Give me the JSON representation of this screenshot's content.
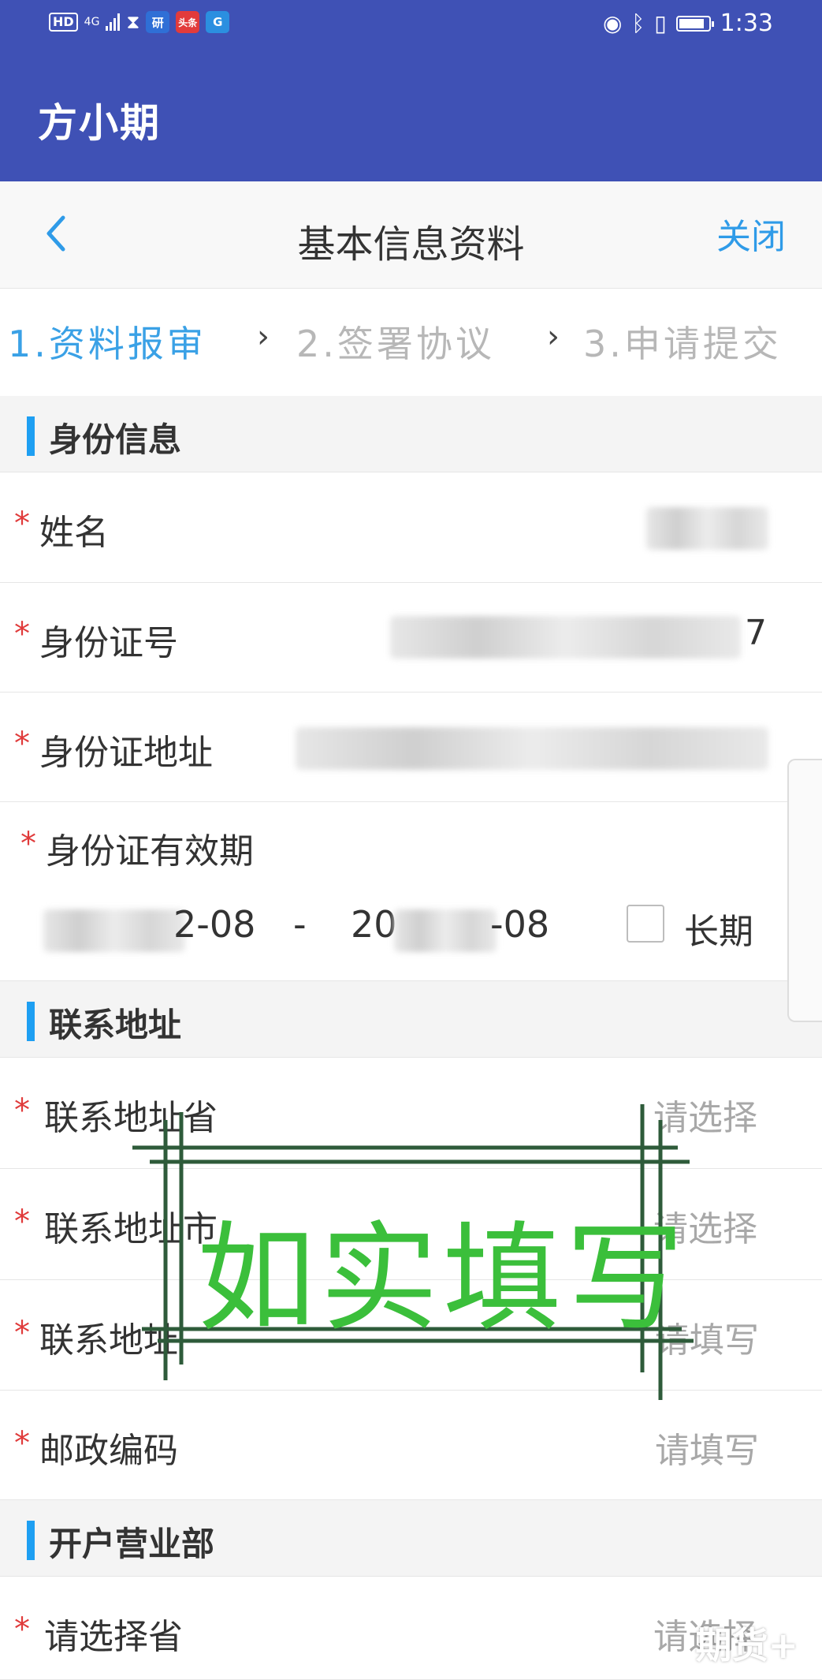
{
  "status_bar": {
    "hd": "HD",
    "network": "4G",
    "app_icons": [
      {
        "name": "research-app-icon",
        "label": "研",
        "color": "#2f6fd6"
      },
      {
        "name": "toutiao-app-icon",
        "label": "头条",
        "color": "#e23b3b"
      },
      {
        "name": "g-app-icon",
        "label": "G",
        "color": "#2b8fe0"
      }
    ],
    "time": "1:33",
    "battery_level": 0.85
  },
  "app_bar": {
    "title": "方小期"
  },
  "nav": {
    "title": "基本信息资料",
    "close_label": "关闭"
  },
  "steps": [
    {
      "label": "1.资料报审",
      "active": true
    },
    {
      "label": "2.签署协议",
      "active": false
    },
    {
      "label": "3.申请提交",
      "active": false
    }
  ],
  "identity_section": {
    "title": "身份信息",
    "name": {
      "label": "姓名",
      "value_visible": "…"
    },
    "id_number": {
      "label": "身份证号",
      "value_visible": "7"
    },
    "id_address": {
      "label": "身份证地址",
      "value_visible": ""
    },
    "id_validity": {
      "label": "身份证有效期",
      "start_visible": "2-08",
      "separator": "-",
      "end_prefix_visible": "20",
      "end_suffix_visible": "-08",
      "long_term_label": "长期",
      "long_term_checked": false
    }
  },
  "contact_section": {
    "title": "联系地址",
    "rows": [
      {
        "label": "联系地址省",
        "placeholder": "请选择"
      },
      {
        "label": "联系地址市",
        "placeholder": "请选择"
      },
      {
        "label": "联系地址",
        "placeholder": "请填写"
      },
      {
        "label": "邮政编码",
        "placeholder": "请填写"
      }
    ]
  },
  "branch_section": {
    "title": "开户营业部",
    "rows": [
      {
        "label": "请选择省",
        "placeholder": "请选择"
      }
    ]
  },
  "required_mark": "*",
  "stamp": {
    "text": "如实填写",
    "color": "#3bbf3b"
  },
  "watermark": "期货+"
}
